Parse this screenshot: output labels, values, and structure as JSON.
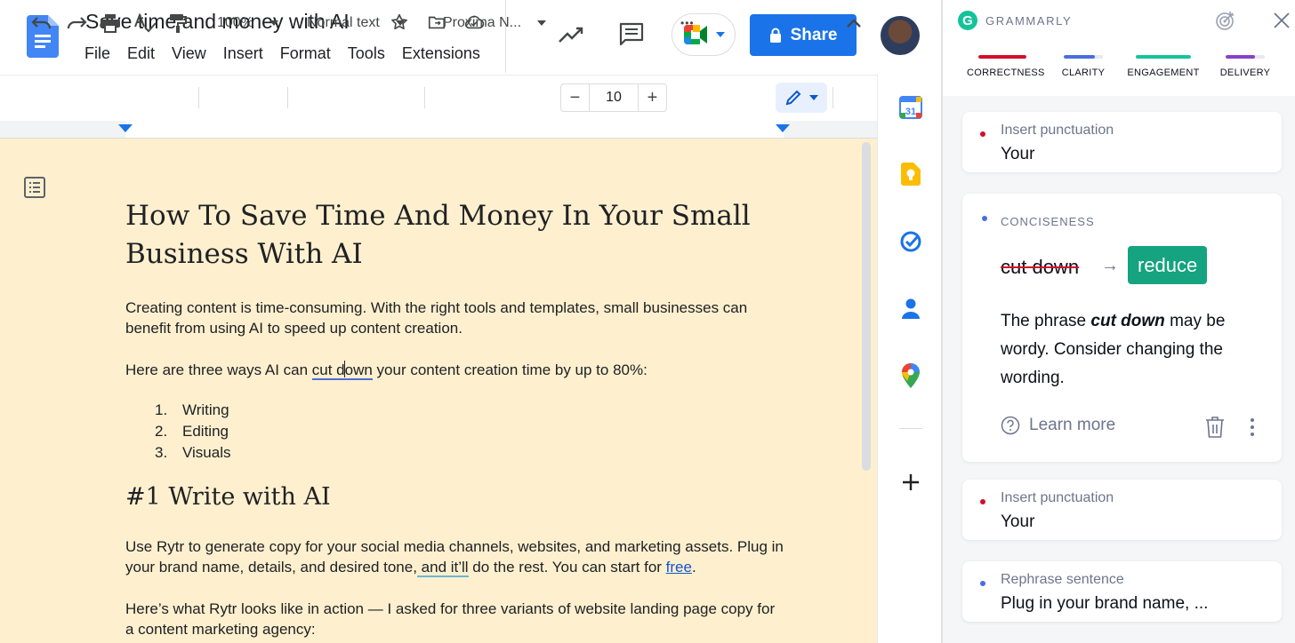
{
  "doc": {
    "title": "Save time and money with AI",
    "menu": [
      "File",
      "Edit",
      "View",
      "Insert",
      "Format",
      "Tools",
      "Extensions"
    ],
    "share_label": "Share"
  },
  "toolbar": {
    "zoom": "100%",
    "style": "Normal text",
    "font": "Proxima N...",
    "font_size": "10",
    "minus": "−",
    "plus": "+",
    "more": "•••"
  },
  "content": {
    "heading": "How To Save Time And Money In Your Small Business With AI",
    "para1": "Creating content is time-consuming. With the right tools and templates, small businesses can benefit from using AI to speed up content creation.",
    "para2_before": "Here are three ways AI can ",
    "para2_mark_a": "cut d",
    "para2_mark_b": "own",
    "para2_after": " your content creation time by up to 80%:",
    "list": [
      {
        "num": "1.",
        "text": "Writing"
      },
      {
        "num": "2.",
        "text": "Editing"
      },
      {
        "num": "3.",
        "text": "Visuals"
      }
    ],
    "h2": "#1 Write with AI",
    "para3_a": "Use Rytr to generate copy for your social media channels, websites, and marketing assets. Plug in your brand name, details, and desired tone,",
    "para3_mark": " and it’ll",
    "para3_b": " do the rest. You can start for ",
    "para3_link": "free",
    "para3_end": ".",
    "para4": "Here’s what Rytr looks like in action — I asked for three variants of website landing page copy for a content marketing agency:"
  },
  "grammarly": {
    "brand": "GRAMMARLY",
    "categories": [
      {
        "label": "CORRECTNESS",
        "color": "#d10f2b",
        "fill": 1.0
      },
      {
        "label": "CLARITY",
        "color": "#4a6ee0",
        "fill": 0.8
      },
      {
        "label": "ENGAGEMENT",
        "color": "#15c39a",
        "fill": 1.0
      },
      {
        "label": "DELIVERY",
        "color": "#8a40c9",
        "fill": 0.75
      }
    ],
    "cards": {
      "c1_label": "Insert punctuation",
      "c1_value": "Your",
      "big_category": "CONCISENESS",
      "big_strike": "cut down",
      "big_arrow": "→",
      "big_suggest": "reduce",
      "big_exp_a": "The phrase ",
      "big_exp_b": "cut down",
      "big_exp_c": " may be wordy. Consider changing the wording.",
      "learn_more": "Learn more",
      "c3_label": "Insert punctuation",
      "c3_value": "Your",
      "c4_label": "Rephrase sentence",
      "c4_value": "Plug in your brand name, ..."
    }
  }
}
